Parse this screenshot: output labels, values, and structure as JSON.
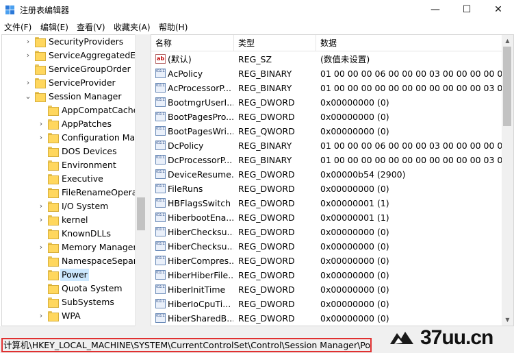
{
  "window": {
    "title": "注册表编辑器",
    "minimize_glyph": "—",
    "maximize_glyph": "☐",
    "close_glyph": "✕"
  },
  "menu": [
    "文件(F)",
    "编辑(E)",
    "查看(V)",
    "收藏夹(A)",
    "帮助(H)"
  ],
  "tree": [
    {
      "label": "SecurityProviders",
      "expander": "›"
    },
    {
      "label": "ServiceAggregatedEv",
      "expander": "›"
    },
    {
      "label": "ServiceGroupOrder",
      "expander": ""
    },
    {
      "label": "ServiceProvider",
      "expander": "›"
    },
    {
      "label": "Session Manager",
      "expander": "⌄"
    },
    {
      "label": "AppCompatCache",
      "expander": ""
    },
    {
      "label": "AppPatches",
      "expander": "›"
    },
    {
      "label": "Configuration Mar",
      "expander": "›"
    },
    {
      "label": "DOS Devices",
      "expander": ""
    },
    {
      "label": "Environment",
      "expander": ""
    },
    {
      "label": "Executive",
      "expander": ""
    },
    {
      "label": "FileRenameOperat",
      "expander": ""
    },
    {
      "label": "I/O System",
      "expander": "›"
    },
    {
      "label": "kernel",
      "expander": "›"
    },
    {
      "label": "KnownDLLs",
      "expander": ""
    },
    {
      "label": "Memory Manager",
      "expander": "›"
    },
    {
      "label": "NamespaceSepara",
      "expander": ""
    },
    {
      "label": "Power",
      "expander": "",
      "selected": true
    },
    {
      "label": "Quota System",
      "expander": ""
    },
    {
      "label": "SubSystems",
      "expander": ""
    },
    {
      "label": "WPA",
      "expander": "›"
    }
  ],
  "columns": {
    "name": "名称",
    "type": "类型",
    "data": "数据"
  },
  "values": [
    {
      "name": "(默认)",
      "type": "REG_SZ",
      "data": "(数值未设置)",
      "icon": "string-value-icon",
      "icon_text": "ab"
    },
    {
      "name": "AcPolicy",
      "type": "REG_BINARY",
      "data": "01 00 00 00 06 00 00 00 03 00 00 00 00 00 0...",
      "icon": "binary-value-icon",
      "icon_text": "011 110"
    },
    {
      "name": "AcProcessorP...",
      "type": "REG_BINARY",
      "data": "01 00 00 00 00 00 00 00 00 00 00 00 03 00 0...",
      "icon": "binary-value-icon",
      "icon_text": "011 110"
    },
    {
      "name": "BootmgrUserI...",
      "type": "REG_DWORD",
      "data": "0x00000000 (0)",
      "icon": "binary-value-icon",
      "icon_text": "011 110"
    },
    {
      "name": "BootPagesPro...",
      "type": "REG_DWORD",
      "data": "0x00000000 (0)",
      "icon": "binary-value-icon",
      "icon_text": "011 110"
    },
    {
      "name": "BootPagesWri...",
      "type": "REG_QWORD",
      "data": "0x00000000 (0)",
      "icon": "binary-value-icon",
      "icon_text": "011 110"
    },
    {
      "name": "DcPolicy",
      "type": "REG_BINARY",
      "data": "01 00 00 00 06 00 00 00 03 00 00 00 00 00 0...",
      "icon": "binary-value-icon",
      "icon_text": "011 110"
    },
    {
      "name": "DcProcessorP...",
      "type": "REG_BINARY",
      "data": "01 00 00 00 00 00 00 00 00 00 00 00 03 00 0...",
      "icon": "binary-value-icon",
      "icon_text": "011 110"
    },
    {
      "name": "DeviceResume...",
      "type": "REG_DWORD",
      "data": "0x00000b54 (2900)",
      "icon": "binary-value-icon",
      "icon_text": "011 110"
    },
    {
      "name": "FileRuns",
      "type": "REG_DWORD",
      "data": "0x00000000 (0)",
      "icon": "binary-value-icon",
      "icon_text": "011 110"
    },
    {
      "name": "HBFlagsSwitch",
      "type": "REG_DWORD",
      "data": "0x00000001 (1)",
      "icon": "binary-value-icon",
      "icon_text": "011 110"
    },
    {
      "name": "HiberbootEna...",
      "type": "REG_DWORD",
      "data": "0x00000001 (1)",
      "icon": "binary-value-icon",
      "icon_text": "011 110"
    },
    {
      "name": "HiberChecksu...",
      "type": "REG_DWORD",
      "data": "0x00000000 (0)",
      "icon": "binary-value-icon",
      "icon_text": "011 110"
    },
    {
      "name": "HiberChecksu...",
      "type": "REG_DWORD",
      "data": "0x00000000 (0)",
      "icon": "binary-value-icon",
      "icon_text": "011 110"
    },
    {
      "name": "HiberCompres...",
      "type": "REG_DWORD",
      "data": "0x00000000 (0)",
      "icon": "binary-value-icon",
      "icon_text": "011 110"
    },
    {
      "name": "HiberHiberFile...",
      "type": "REG_DWORD",
      "data": "0x00000000 (0)",
      "icon": "binary-value-icon",
      "icon_text": "011 110"
    },
    {
      "name": "HiberInitTime",
      "type": "REG_DWORD",
      "data": "0x00000000 (0)",
      "icon": "binary-value-icon",
      "icon_text": "011 110"
    },
    {
      "name": "HiberIoCpuTi...",
      "type": "REG_DWORD",
      "data": "0x00000000 (0)",
      "icon": "binary-value-icon",
      "icon_text": "011 110"
    },
    {
      "name": "HiberSharedB...",
      "type": "REG_DWORD",
      "data": "0x00000000 (0)",
      "icon": "binary-value-icon",
      "icon_text": "011 110"
    }
  ],
  "status": {
    "path": "计算机\\HKEY_LOCAL_MACHINE\\SYSTEM\\CurrentControlSet\\Control\\Session Manager\\Power"
  },
  "watermark": {
    "text": "37uu.cn"
  },
  "colors": {
    "selection": "#cce8ff",
    "status_highlight": "#e03030",
    "folder": "#ffd75e"
  }
}
